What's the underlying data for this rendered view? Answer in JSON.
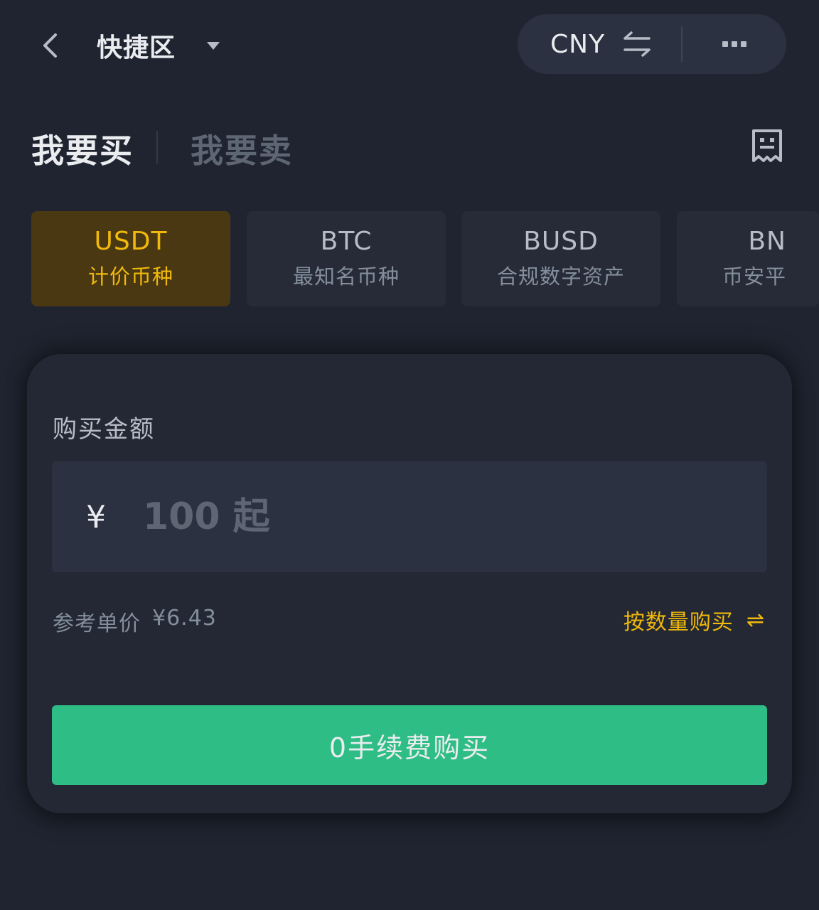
{
  "header": {
    "title": "快捷区",
    "currency": "CNY"
  },
  "tabs": {
    "buy": "我要买",
    "sell": "我要卖"
  },
  "coins": [
    {
      "name": "USDT",
      "desc": "计价币种",
      "active": true
    },
    {
      "name": "BTC",
      "desc": "最知名币种",
      "active": false
    },
    {
      "name": "BUSD",
      "desc": "合规数字资产",
      "active": false
    },
    {
      "name": "BN",
      "desc": "币安平",
      "active": false
    }
  ],
  "form": {
    "amount_label": "购买金额",
    "currency_symbol": "¥",
    "amount_placeholder": "100 起",
    "ref_price_label": "参考单价",
    "ref_price_value": "¥6.43",
    "by_quantity_label": "按数量购买",
    "by_quantity_icon": "⇌",
    "buy_button": "0手续费购买"
  },
  "colors": {
    "background": "#1f2430",
    "accent": "#f0b90b",
    "buy_green": "#2ebd85",
    "active_card": "#4a3812"
  }
}
